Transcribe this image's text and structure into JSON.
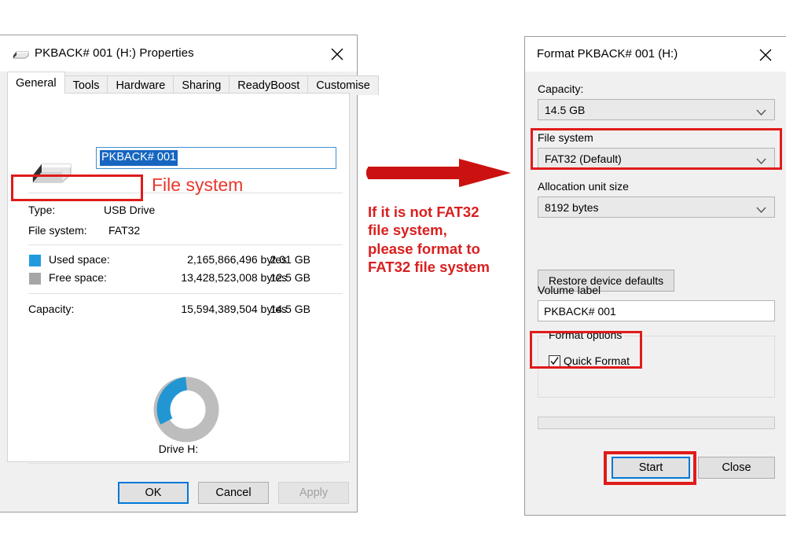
{
  "properties_dialog": {
    "title": "PKBACK# 001 (H:) Properties",
    "title_icon": "usb-drive-icon",
    "close_icon": "close-icon",
    "tabs": [
      {
        "label": "General",
        "active": true
      },
      {
        "label": "Tools",
        "active": false
      },
      {
        "label": "Hardware",
        "active": false
      },
      {
        "label": "Sharing",
        "active": false
      },
      {
        "label": "ReadyBoost",
        "active": false
      },
      {
        "label": "Customise",
        "active": false
      }
    ],
    "volume_label_input": {
      "value": "PKBACK# 001",
      "selected": true
    },
    "info": {
      "type_label": "Type:",
      "type_value": "USB Drive",
      "filesystem_label": "File system:",
      "filesystem_value": "FAT32",
      "used_label": "Used space:",
      "used_bytes": "2,165,866,496 bytes",
      "used_gb": "2.01 GB",
      "free_label": "Free space:",
      "free_bytes": "13,428,523,008 bytes",
      "free_gb": "12.5 GB",
      "capacity_label": "Capacity:",
      "capacity_bytes": "15,594,389,504 bytes",
      "capacity_gb": "14.5 GB",
      "drive_caption": "Drive H:"
    },
    "colors": {
      "used": "#1f9bdd",
      "free": "#a6a6a6"
    },
    "buttons": {
      "ok": "OK",
      "cancel": "Cancel",
      "apply": "Apply"
    }
  },
  "format_dialog": {
    "title": "Format PKBACK# 001 (H:)",
    "close_icon": "close-icon",
    "capacity_label": "Capacity:",
    "capacity_value": "14.5 GB",
    "filesystem_label": "File system",
    "filesystem_value": "FAT32 (Default)",
    "allocation_label": "Allocation unit size",
    "allocation_value": "8192 bytes",
    "restore_defaults": "Restore device defaults",
    "volume_label_label": "Volume label",
    "volume_label_value": "PKBACK# 001",
    "format_options_label": "Format options",
    "quick_format_label": "Quick Format",
    "quick_format_checked": true,
    "buttons": {
      "start": "Start",
      "close": "Close"
    }
  },
  "annotations": {
    "arrow_icon": "right-arrow-icon",
    "filesystem_callout": "File system",
    "instruction_lines": [
      "If it is not FAT32",
      "file system,",
      "please format to",
      "FAT32 file system"
    ],
    "colors": {
      "red_box": "#e01b1b",
      "red_text": "#d91f1f",
      "callout_text": "#e8372b"
    }
  },
  "chart_data": {
    "type": "pie",
    "title": "Drive H:",
    "categories": [
      "Used space",
      "Free space"
    ],
    "values": [
      2165866496,
      13428523008
    ],
    "display_values": [
      "2.01 GB",
      "12.5 GB"
    ],
    "percentages": [
      13.9,
      86.1
    ],
    "colors": [
      "#1f9bdd",
      "#a6a6a6"
    ],
    "total": 15594389504,
    "total_display": "14.5 GB",
    "legend": "left",
    "donut": true
  }
}
